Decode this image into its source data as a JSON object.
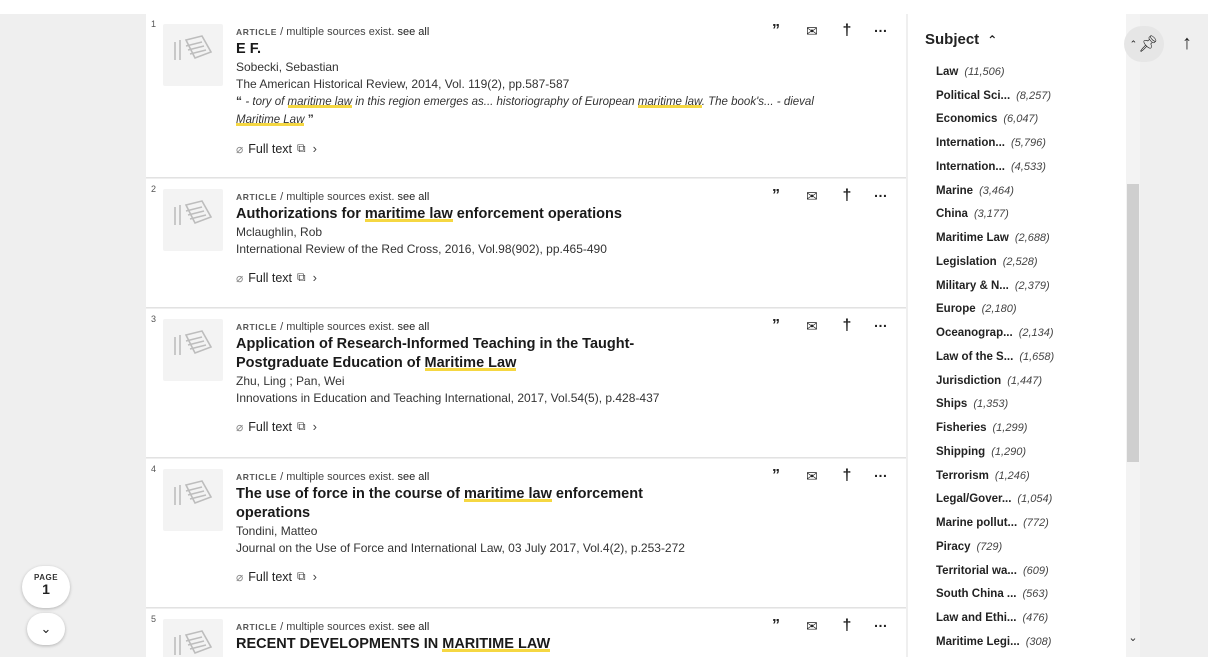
{
  "results": [
    {
      "index": "1",
      "type": "ARTICLE",
      "type_suffix": " / multiple sources exist. ",
      "see_all": "see all",
      "title_parts": [
        {
          "t": "E F.",
          "m": false
        }
      ],
      "author": "Sobecki, Sebastian",
      "source": "The American Historical Review, 2014, Vol. 119(2), pp.587-587",
      "snippet_parts": [
        {
          "t": "“ ",
          "m": false,
          "q": true
        },
        {
          "t": " - tory of ",
          "m": false
        },
        {
          "t": "maritime law",
          "m": true
        },
        {
          "t": " in this region emerges as... historiography of European ",
          "m": false
        },
        {
          "t": "maritime law",
          "m": true
        },
        {
          "t": ". The book's... - dieval ",
          "m": false
        },
        {
          "t": "Maritime Law",
          "m": true
        },
        {
          "t": " ”",
          "m": false,
          "q": true
        }
      ],
      "full_text": "Full text"
    },
    {
      "index": "2",
      "type": "ARTICLE",
      "type_suffix": " / multiple sources exist. ",
      "see_all": "see all",
      "title_parts": [
        {
          "t": "Authorizations for ",
          "m": false
        },
        {
          "t": "maritime law",
          "m": true
        },
        {
          "t": " enforcement operations",
          "m": false
        }
      ],
      "author": "Mclaughlin, Rob",
      "source": "International Review of the Red Cross, 2016, Vol.98(902), pp.465-490",
      "snippet_parts": [],
      "full_text": "Full text"
    },
    {
      "index": "3",
      "type": "ARTICLE",
      "type_suffix": " / multiple sources exist. ",
      "see_all": "see all",
      "title_parts": [
        {
          "t": "Application of Research-Informed Teaching in the Taught-",
          "m": false
        },
        {
          "br": true
        },
        {
          "t": "Postgraduate Education of ",
          "m": false
        },
        {
          "t": "Maritime Law",
          "m": true
        }
      ],
      "author": "Zhu, Ling ; Pan, Wei",
      "source": "Innovations in Education and Teaching International, 2017, Vol.54(5), p.428-437",
      "snippet_parts": [],
      "full_text": "Full text"
    },
    {
      "index": "4",
      "type": "ARTICLE",
      "type_suffix": " / multiple sources exist. ",
      "see_all": "see all",
      "title_parts": [
        {
          "t": "The use of force in the course of ",
          "m": false
        },
        {
          "t": "maritime law",
          "m": true
        },
        {
          "t": " enforcement",
          "m": false
        },
        {
          "br": true
        },
        {
          "t": "operations",
          "m": false
        }
      ],
      "author": "Tondini, Matteo",
      "source": "Journal on the Use of Force and International Law, 03 July 2017, Vol.4(2), p.253-272",
      "snippet_parts": [],
      "full_text": "Full text"
    },
    {
      "index": "5",
      "type": "ARTICLE",
      "type_suffix": " / multiple sources exist. ",
      "see_all": "see all",
      "title_parts": [
        {
          "t": "RECENT DEVELOPMENTS IN ",
          "m": false
        },
        {
          "t": "MARITIME LAW",
          "m": true
        }
      ],
      "author": "",
      "source": "",
      "snippet_parts": [],
      "full_text": ""
    }
  ],
  "facet": {
    "header": "Subject",
    "items": [
      {
        "name": "Law",
        "count": "(11,506)"
      },
      {
        "name": "Political Sci...",
        "count": "(8,257)"
      },
      {
        "name": "Economics",
        "count": "(6,047)"
      },
      {
        "name": "Internation...",
        "count": "(5,796)"
      },
      {
        "name": "Internation...",
        "count": "(4,533)"
      },
      {
        "name": "Marine",
        "count": "(3,464)"
      },
      {
        "name": "China",
        "count": "(3,177)"
      },
      {
        "name": "Maritime Law",
        "count": "(2,688)"
      },
      {
        "name": "Legislation",
        "count": "(2,528)"
      },
      {
        "name": "Military & N...",
        "count": "(2,379)"
      },
      {
        "name": "Europe",
        "count": "(2,180)"
      },
      {
        "name": "Oceanograp...",
        "count": "(2,134)"
      },
      {
        "name": "Law of the S...",
        "count": "(1,658)"
      },
      {
        "name": "Jurisdiction",
        "count": "(1,447)"
      },
      {
        "name": "Ships",
        "count": "(1,353)"
      },
      {
        "name": "Fisheries",
        "count": "(1,299)"
      },
      {
        "name": "Shipping",
        "count": "(1,290)"
      },
      {
        "name": "Terrorism",
        "count": "(1,246)"
      },
      {
        "name": "Legal/Gover...",
        "count": "(1,054)"
      },
      {
        "name": "Marine pollut...",
        "count": "(772)"
      },
      {
        "name": "Piracy",
        "count": "(729)"
      },
      {
        "name": "Territorial wa...",
        "count": "(609)"
      },
      {
        "name": "South China ...",
        "count": "(563)"
      },
      {
        "name": "Law and Ethi...",
        "count": "(476)"
      },
      {
        "name": "Maritime Legi...",
        "count": "(308)"
      }
    ]
  },
  "pagination": {
    "label": "PAGE",
    "number": "1"
  },
  "icons": {
    "cite": "cite-icon",
    "email": "email-icon",
    "pin": "pin-icon",
    "more": "more-icon",
    "link": "link-icon",
    "external": "external-link-icon",
    "collapse": "chevron-up-icon",
    "back_to_top": "arrow-up-icon"
  },
  "colors": {
    "highlight": "#f5d742",
    "background": "#efefef",
    "card": "#ffffff"
  }
}
